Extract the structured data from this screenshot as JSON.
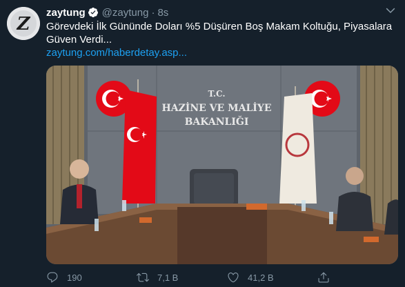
{
  "tweet": {
    "author_name": "zaytung",
    "handle": "@zaytung",
    "separator": "·",
    "time": "8s",
    "text": "Görevdeki İlk Gününde Doları %5 Düşüren Boş Makam Koltuğu, Piyasalara Güven Verdi...",
    "link": "zaytung.com/haberdetay.asp...",
    "avatar_letter": "Z"
  },
  "media": {
    "sign_line1": "T.C.",
    "sign_line2": "HAZİNE VE MALİYE",
    "sign_line3": "BAKANLIĞI"
  },
  "actions": {
    "reply_count": "190",
    "retweet_count": "7,1 B",
    "like_count": "41,2 B"
  },
  "colors": {
    "background": "#15202b",
    "secondary_text": "#8899a6",
    "link": "#1da1f2",
    "flag_red": "#e30a17"
  },
  "icons": [
    "verified-icon",
    "more-icon",
    "reply-icon",
    "retweet-icon",
    "like-icon",
    "share-icon"
  ]
}
